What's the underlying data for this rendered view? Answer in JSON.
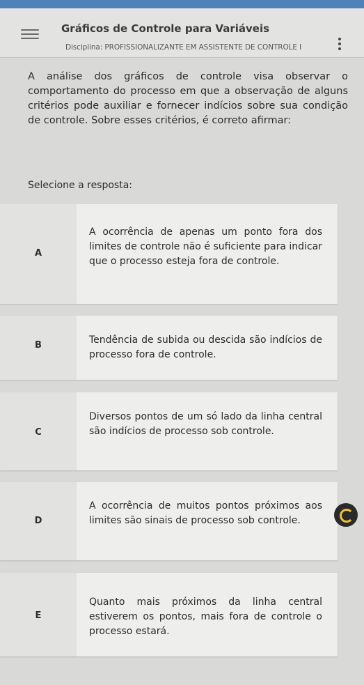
{
  "header": {
    "title": "Gráficos de Controle para Variáveis",
    "subtitle": "Disciplina: PROFISSIONALIZANTE EM ASSISTENTE DE CONTROLE I"
  },
  "question": {
    "text": "A análise dos gráficos de controle visa observar o comportamento do processo em que a observação de alguns critérios pode auxiliar e fornecer indícios sobre sua condição de controle. Sobre esses critérios, é correto afirmar:",
    "prompt": "Selecione a resposta:"
  },
  "options": [
    {
      "letter": "A",
      "text": "A ocorrência de apenas um ponto fora dos limites de controle não é suficiente para indicar que o processo esteja fora de controle."
    },
    {
      "letter": "B",
      "text": "Tendência de subida ou descida são indícios de processo fora de controle."
    },
    {
      "letter": "C",
      "text": "Diversos pontos de um só lado da linha central são indícios de processo sob controle."
    },
    {
      "letter": "D",
      "text": "A ocorrência de muitos pontos próximos aos limites são sinais de processo sob controle."
    },
    {
      "letter": "E",
      "text": "Quanto mais próximos da linha central estiverem os pontos, mais fora de controle o processo estará."
    }
  ],
  "colors": {
    "topbar": "#4f82b8",
    "badge_accent": "#f2c23a"
  }
}
